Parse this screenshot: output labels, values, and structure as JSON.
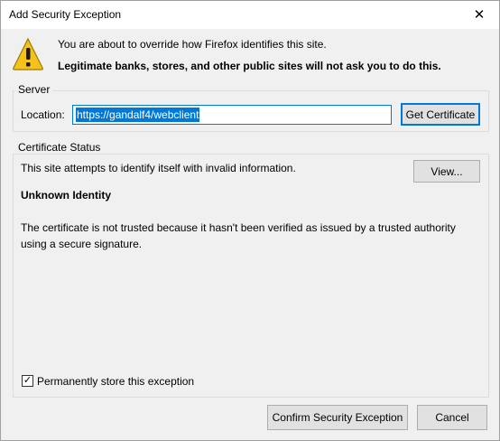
{
  "window": {
    "title": "Add Security Exception",
    "close_glyph": "✕"
  },
  "header": {
    "message": "You are about to override how Firefox identifies this site.",
    "warning": "Legitimate banks, stores, and other public sites will not ask you to do this.",
    "icon": "warning-icon",
    "icon_color": "#f4c21b"
  },
  "server": {
    "group_label": "Server",
    "location_label": "Location:",
    "location_value": "https://gandalf4/webclient",
    "get_certificate_label": "Get Certificate"
  },
  "certificate_status": {
    "group_label": "Certificate Status",
    "summary": "This site attempts to identify itself with invalid information.",
    "view_label": "View...",
    "heading": "Unknown Identity",
    "description": "The certificate is not trusted because it hasn't been verified as issued by a trusted authority using a secure signature."
  },
  "options": {
    "permanent_checked": true,
    "permanent_label": "Permanently store this exception"
  },
  "footer": {
    "confirm_label": "Confirm Security Exception",
    "cancel_label": "Cancel"
  },
  "colors": {
    "accent": "#0078d7",
    "dialog_bg": "#f0f0f0",
    "button_bg": "#e1e1e1"
  }
}
